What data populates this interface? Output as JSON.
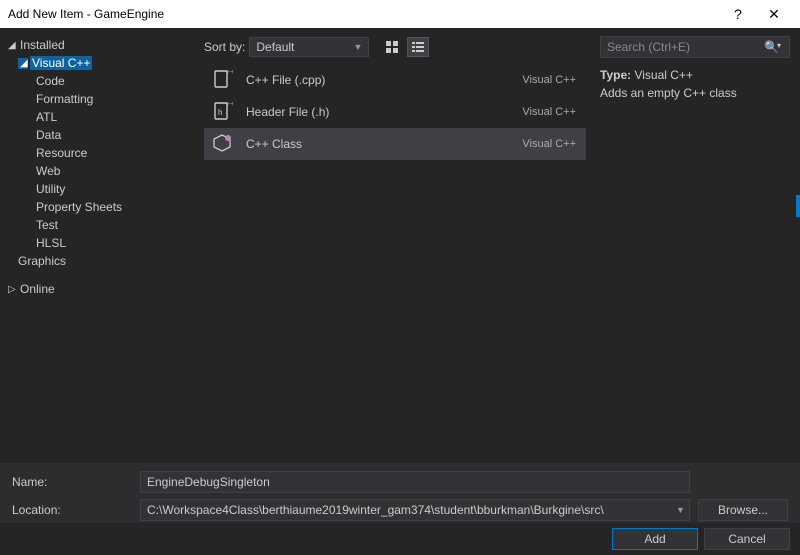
{
  "window": {
    "title": "Add New Item - GameEngine",
    "help": "?",
    "close": "✕"
  },
  "tree": {
    "installed": "Installed",
    "visualcpp": "Visual C++",
    "children": [
      "Code",
      "Formatting",
      "ATL",
      "Data",
      "Resource",
      "Web",
      "Utility",
      "Property Sheets",
      "Test",
      "HLSL"
    ],
    "graphics": "Graphics",
    "online": "Online"
  },
  "sort": {
    "label": "Sort by:",
    "value": "Default"
  },
  "items": [
    {
      "name": "C++ File (.cpp)",
      "lang": "Visual C++"
    },
    {
      "name": "Header File (.h)",
      "lang": "Visual C++"
    },
    {
      "name": "C++ Class",
      "lang": "Visual C++"
    }
  ],
  "search": {
    "placeholder": "Search (Ctrl+E)"
  },
  "info": {
    "type_label": "Type:",
    "type_value": "Visual C++",
    "desc": "Adds an empty C++ class"
  },
  "form": {
    "name_label": "Name:",
    "name_value": "EngineDebugSingleton",
    "loc_label": "Location:",
    "loc_value": "C:\\Workspace4Class\\berthiaume2019winter_gam374\\student\\bburkman\\Burkgine\\src\\",
    "browse": "Browse..."
  },
  "footer": {
    "add": "Add",
    "cancel": "Cancel"
  }
}
